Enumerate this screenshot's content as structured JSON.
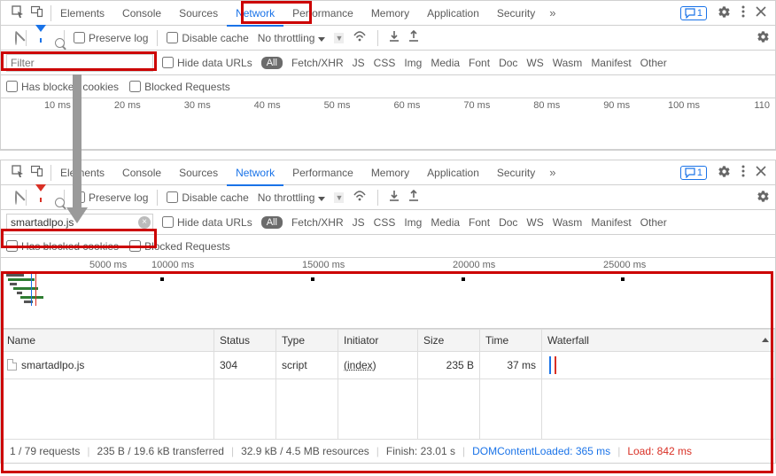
{
  "tabs": {
    "elements": "Elements",
    "console": "Console",
    "sources": "Sources",
    "network": "Network",
    "performance": "Performance",
    "memory": "Memory",
    "application": "Application",
    "security": "Security",
    "messages_count": "1"
  },
  "toolbar": {
    "preserve_log": "Preserve log",
    "disable_cache": "Disable cache",
    "throttling": "No throttling"
  },
  "filter": {
    "placeholder": "Filter",
    "value_panel2": "smartadlpo.js",
    "hide_data_urls": "Hide data URLs",
    "all": "All",
    "types": {
      "fetch_xhr": "Fetch/XHR",
      "js": "JS",
      "css": "CSS",
      "img": "Img",
      "media": "Media",
      "font": "Font",
      "doc": "Doc",
      "ws": "WS",
      "wasm": "Wasm",
      "manifest": "Manifest",
      "other": "Other"
    },
    "has_blocked_cookies": "Has blocked cookies",
    "blocked_requests": "Blocked Requests"
  },
  "timeline1": {
    "ticks": [
      "10 ms",
      "20 ms",
      "30 ms",
      "40 ms",
      "50 ms",
      "60 ms",
      "70 ms",
      "80 ms",
      "90 ms",
      "100 ms",
      "110"
    ]
  },
  "timeline2": {
    "ticks": [
      "5000 ms",
      "10000 ms",
      "15000 ms",
      "20000 ms",
      "25000 ms"
    ]
  },
  "table": {
    "headers": {
      "name": "Name",
      "status": "Status",
      "type": "Type",
      "initiator": "Initiator",
      "size": "Size",
      "time": "Time",
      "waterfall": "Waterfall"
    },
    "rows": [
      {
        "name": "smartadlpo.js",
        "status": "304",
        "type": "script",
        "initiator": "(index)",
        "size": "235 B",
        "time": "37 ms"
      }
    ]
  },
  "status": {
    "requests": "1 / 79 requests",
    "transferred": "235 B / 19.6 kB transferred",
    "resources": "32.9 kB / 4.5 MB resources",
    "finish": "Finish: 23.01 s",
    "domcontentloaded": "DOMContentLoaded: 365 ms",
    "load": "Load: 842 ms"
  }
}
